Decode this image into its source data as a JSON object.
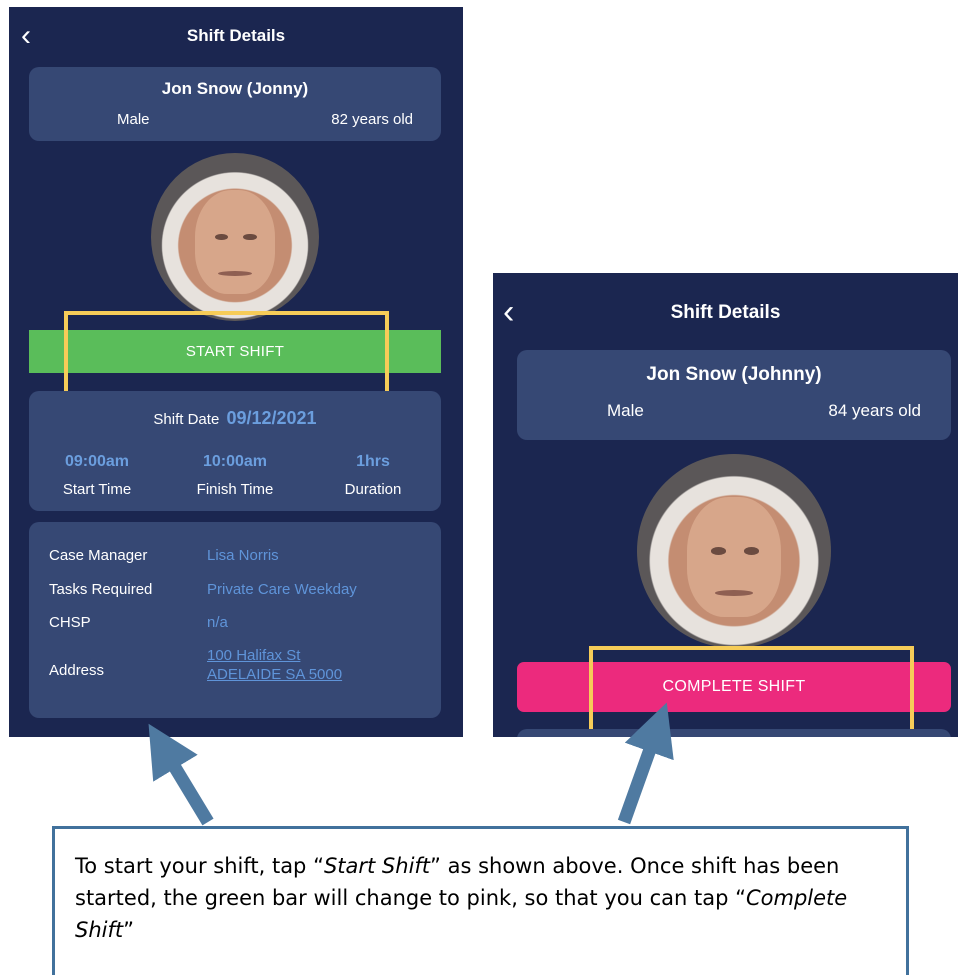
{
  "left_screen": {
    "back_icon": "chevron-left",
    "title": "Shift Details",
    "patient_name": "Jon Snow (Jonny)",
    "gender": "Male",
    "age": "82 years old",
    "start_button": "START SHIFT",
    "shift_date_label": "Shift Date",
    "shift_date_value": "09/12/2021",
    "start_time": "09:00am",
    "finish_time": "10:00am",
    "duration": "1hrs",
    "start_time_label": "Start Time",
    "finish_time_label": "Finish Time",
    "duration_label": "Duration",
    "case_manager_label": "Case Manager",
    "case_manager_value": "Lisa Norris",
    "tasks_label": "Tasks Required",
    "tasks_value": "Private Care Weekday",
    "chsp_label": "CHSP",
    "chsp_value": "n/a",
    "address_label": "Address",
    "address_line1": "100 Halifax St",
    "address_line2": "ADELAIDE SA 5000"
  },
  "right_screen": {
    "back_icon": "chevron-left",
    "title": "Shift Details",
    "patient_name": "Jon Snow (Johnny)",
    "gender": "Male",
    "age": "84 years old",
    "complete_button": "COMPLETE SHIFT"
  },
  "note": {
    "text_before_1": "To start your shift, tap “",
    "emph_1": "Start Shift",
    "text_after_1": "” as shown above. Once shift has been started, the green bar will change to pink, so that you can tap “",
    "emph_2": "Complete Shift",
    "text_after_2": "”"
  },
  "colors": {
    "screen_bg": "#1b2650",
    "card_bg": "#364874",
    "start_green": "#5abd5a",
    "complete_pink": "#ec2a7d",
    "highlight_yellow": "#f6cc58",
    "accent_blue": "#6b9ede",
    "arrow_blue": "#4f7aa1"
  }
}
